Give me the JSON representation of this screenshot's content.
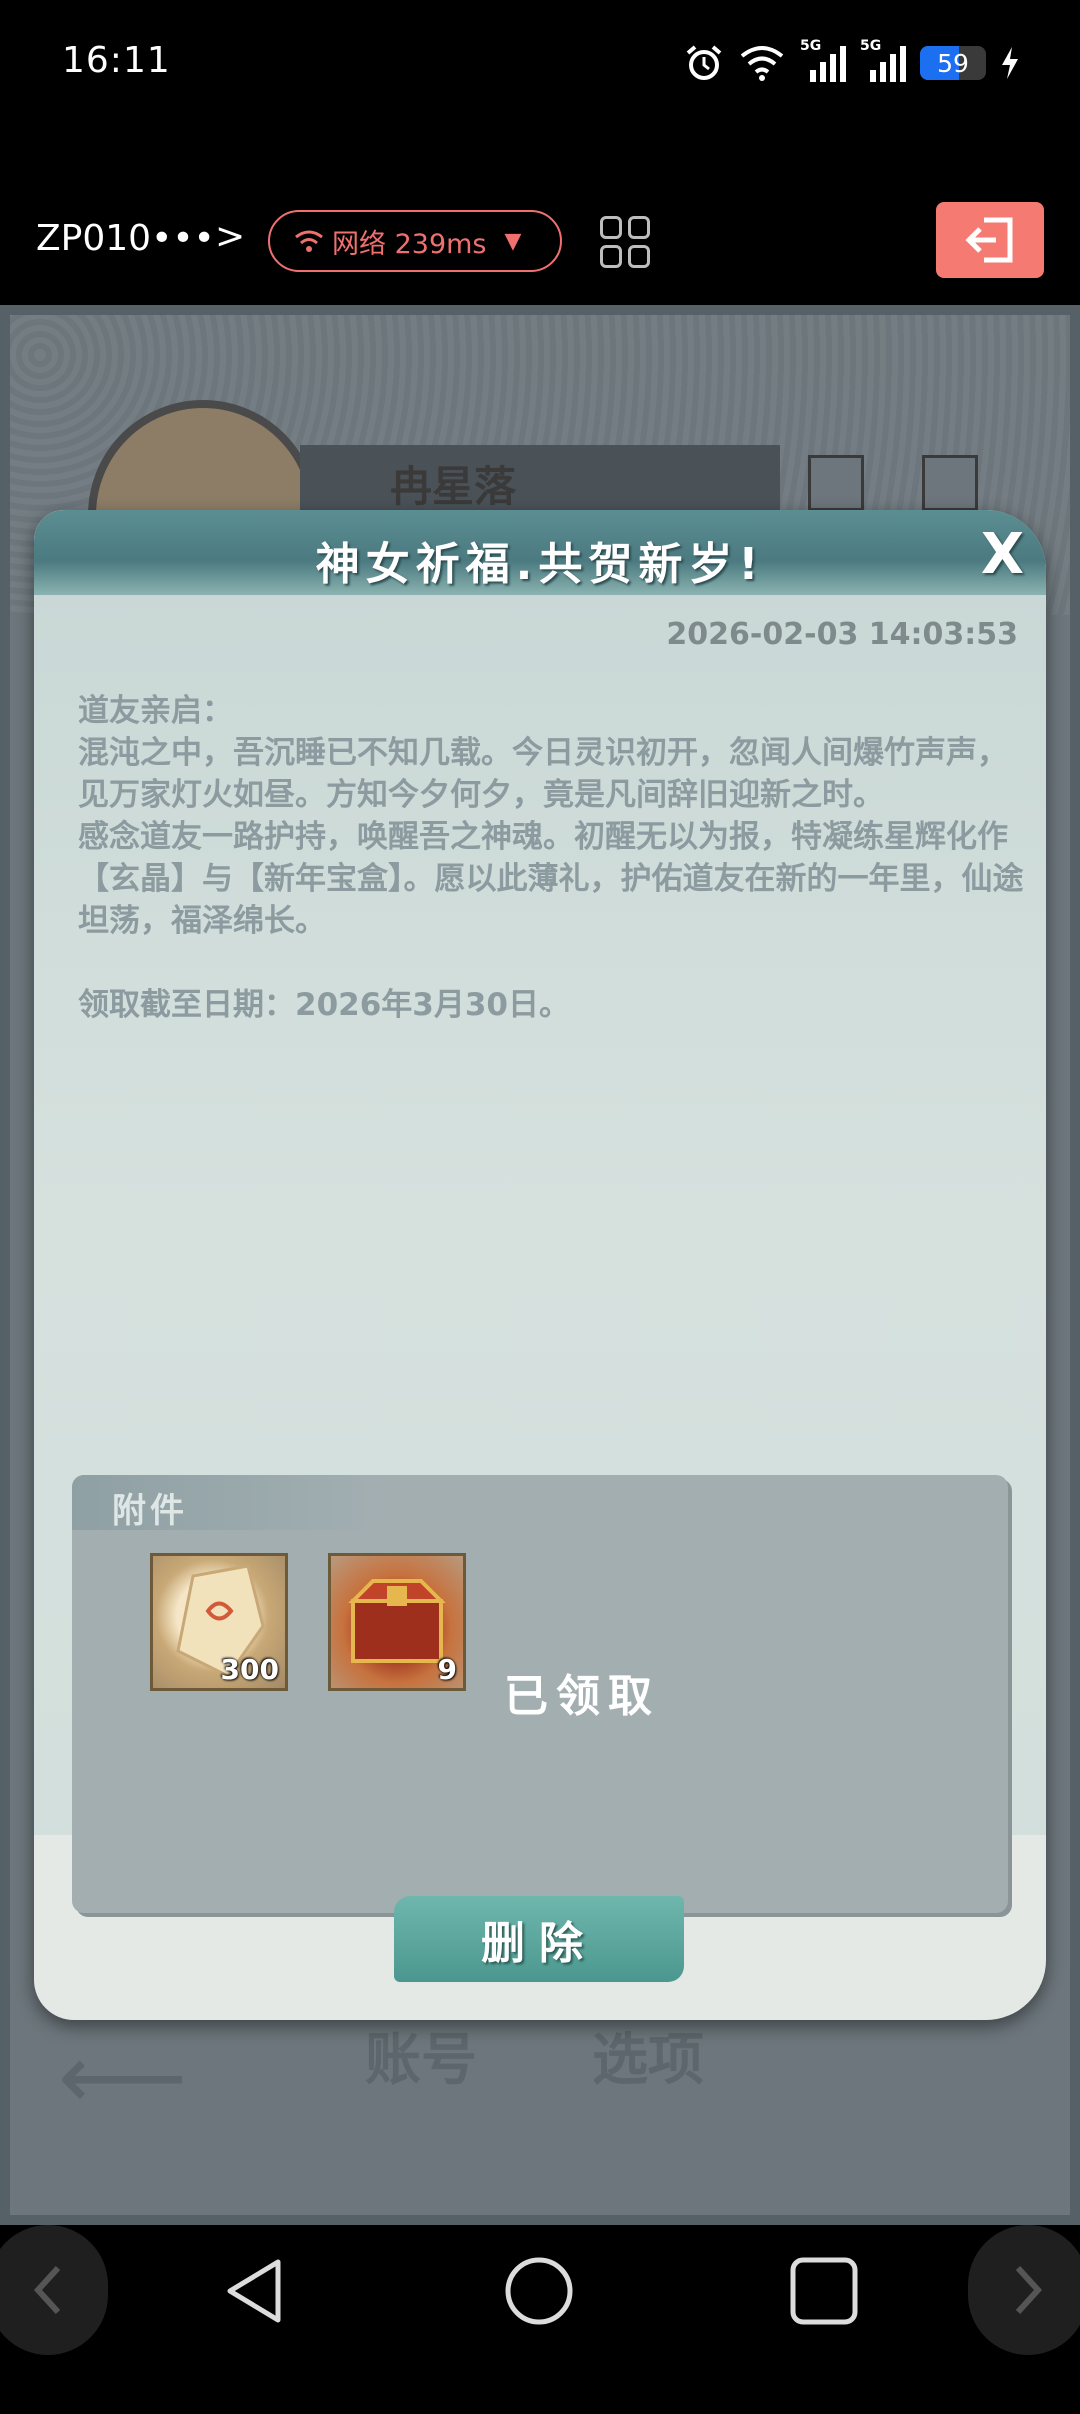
{
  "status_bar": {
    "time": "16:11",
    "signal1_tag": "5G",
    "signal2_tag": "5G",
    "battery": "59",
    "battery_level": 0.59
  },
  "app_bar": {
    "device_name": "ZP010•••",
    "chevron": ">",
    "network_label": "网络 239ms",
    "accent_color": "#f47a72"
  },
  "game": {
    "player_name": "冉星落",
    "tab_account": "账号",
    "tab_options": "选项"
  },
  "dialog": {
    "title": "神女祈福.共贺新岁!",
    "close": "X",
    "date": "2026-02-03 14:03:53",
    "body": "道友亲启：\n混沌之中，吾沉睡已不知几载。今日灵识初开，忽闻人间爆竹声声，见万家灯火如昼。方知今夕何夕，竟是凡间辞旧迎新之时。\n感念道友一路护持，唤醒吾之神魂。初醒无以为报，特凝练星辉化作【玄晶】与【新年宝盒】。愿以此薄礼，护佑道友在新的一年里，仙途坦荡，福泽绵长。\n\n领取截至日期：2026年3月30日。",
    "attachments_label": "附件",
    "items": [
      {
        "name": "玄晶",
        "count": "300"
      },
      {
        "name": "新年宝盒",
        "count": "9"
      }
    ],
    "claimed_text": "已领取",
    "delete_label": "删除"
  }
}
